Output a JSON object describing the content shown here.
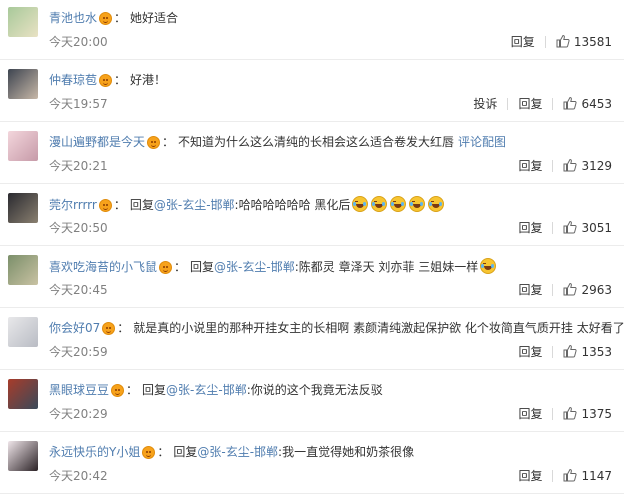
{
  "like_icon": "thumbs-up-icon",
  "crown_icon": "vip-crown-icon",
  "comments": [
    {
      "user": "青池也水",
      "text": "她好适合",
      "time": "今天20:00",
      "actions": [
        "回复"
      ],
      "likes": "13581"
    },
    {
      "user": "仲春琼苞",
      "text": "好港！",
      "time": "今天19:57",
      "actions": [
        "投诉",
        "回复"
      ],
      "likes": "6453"
    },
    {
      "user": "漫山遍野都是今天",
      "text": "不知道为什么这么清纯的长相会这么适合卷发大红唇",
      "extra": "评论配图",
      "time": "今天20:21",
      "actions": [
        "回复"
      ],
      "likes": "3129"
    },
    {
      "user": "莞尔rrrrr",
      "reply_prefix": "回复",
      "mention": "@张-玄尘-邯郸",
      "text": ":哈哈哈哈哈哈 黑化后",
      "emojis": 5,
      "time": "今天20:50",
      "actions": [
        "回复"
      ],
      "likes": "3051"
    },
    {
      "user": "喜欢吃海苔的小飞鼠",
      "reply_prefix": "回复",
      "mention": "@张-玄尘-邯郸",
      "text": ":陈都灵 章泽天 刘亦菲 三姐妹一样",
      "emojis": 1,
      "time": "今天20:45",
      "actions": [
        "回复"
      ],
      "likes": "2963"
    },
    {
      "user": "你会好07",
      "text": "就是真的小说里的那种开挂女主的长相啊 素颜清纯激起保护欲 化个妆简直气质开挂 太好看了",
      "time": "今天20:59",
      "actions": [
        "回复"
      ],
      "likes": "1353"
    },
    {
      "user": "黑眼球豆豆",
      "reply_prefix": "回复",
      "mention": "@张-玄尘-邯郸",
      "text": ":你说的这个我竟无法反驳",
      "time": "今天20:29",
      "actions": [
        "回复"
      ],
      "likes": "1375"
    },
    {
      "user": "永远快乐的Y小姐",
      "reply_prefix": "回复",
      "mention": "@张-玄尘-邯郸",
      "text": ":我一直觉得她和奶茶很像",
      "time": "今天20:42",
      "actions": [
        "回复"
      ],
      "likes": "1147"
    }
  ]
}
